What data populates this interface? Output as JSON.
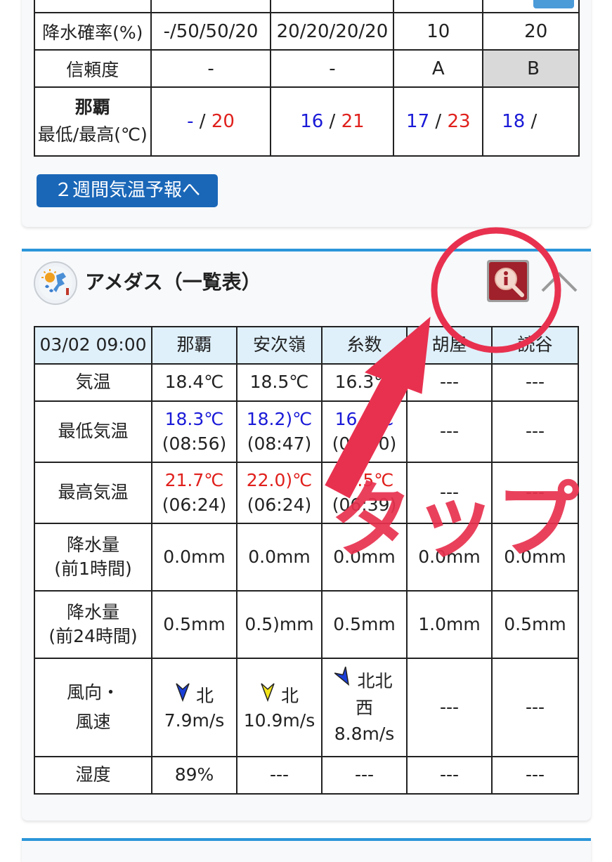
{
  "forecast": {
    "rows": [
      {
        "label": "降水確率(%)",
        "cells": [
          "-/50/50/20",
          "20/20/20/20",
          "10",
          "20"
        ]
      },
      {
        "label": "信頼度",
        "cells": [
          "-",
          "-",
          "A",
          "B"
        ]
      }
    ],
    "temp_row": {
      "label_city": "那覇",
      "label_unit": "最低/最高(℃)",
      "cells": [
        {
          "min": "-",
          "sep": "/",
          "max": "20"
        },
        {
          "min": "16",
          "sep": "/",
          "max": "21"
        },
        {
          "min": "17",
          "sep": "/",
          "max": "23"
        },
        {
          "min": "18",
          "sep": "/",
          "max": ""
        }
      ]
    },
    "next_label": ">",
    "two_week_button": "２週間気温予報へ"
  },
  "amedas": {
    "title": "アメダス（一覧表）",
    "header": [
      "03/02 09:00",
      "那覇",
      "安次嶺",
      "糸数",
      "胡屋",
      "読谷"
    ],
    "temp": {
      "label": "気温",
      "values": [
        "18.4℃",
        "18.5℃",
        "16.3℃",
        "---",
        "---"
      ]
    },
    "min_temp": {
      "label": "最低気温",
      "values": [
        {
          "value": "18.3℃",
          "time": "(08:56)"
        },
        {
          "value": "18.2)℃",
          "time": "(08:47)"
        },
        {
          "value": "16.2℃",
          "time": "(09:00)"
        },
        {
          "value": "---",
          "time": ""
        },
        {
          "value": "---",
          "time": ""
        }
      ]
    },
    "max_temp": {
      "label": "最高気温",
      "values": [
        {
          "value": "21.7℃",
          "time": "(06:24)"
        },
        {
          "value": "22.0)℃",
          "time": "(06:24)"
        },
        {
          "value": "19.5℃",
          "time": "(06:39)"
        },
        {
          "value": "---",
          "time": ""
        },
        {
          "value": "---",
          "time": ""
        }
      ]
    },
    "precip1": {
      "label1": "降水量",
      "label2": "(前1時間)",
      "values": [
        "0.0mm",
        "0.0mm",
        "0.0mm",
        "0.0mm",
        "0.0mm"
      ]
    },
    "precip24": {
      "label1": "降水量",
      "label2": "(前24時間)",
      "values": [
        "0.5mm",
        "0.5)mm",
        "0.5mm",
        "1.0mm",
        "0.5mm"
      ]
    },
    "wind": {
      "label1": "風向・",
      "label2": "風速",
      "values": [
        {
          "dir": "北",
          "speed": "7.9m/s",
          "color": "#1a3fd8"
        },
        {
          "dir": "北",
          "speed": "10.9m/s",
          "color": "#f2e31a"
        },
        {
          "dir": "北北西",
          "speed": "8.8m/s",
          "color": "#1a3fd8"
        },
        {
          "dir": "---",
          "speed": "",
          "color": ""
        },
        {
          "dir": "---",
          "speed": "",
          "color": ""
        }
      ]
    },
    "humidity": {
      "label": "湿度",
      "values": [
        "89%",
        "---",
        "---",
        "---",
        "---"
      ]
    }
  },
  "annotation": {
    "text": "タップ",
    "color": "#e8314f"
  },
  "colors": {
    "accent": "#2b96d9",
    "button": "#1a67b8",
    "min_temp": "#1a1ad8",
    "max_temp": "#e0201c"
  }
}
